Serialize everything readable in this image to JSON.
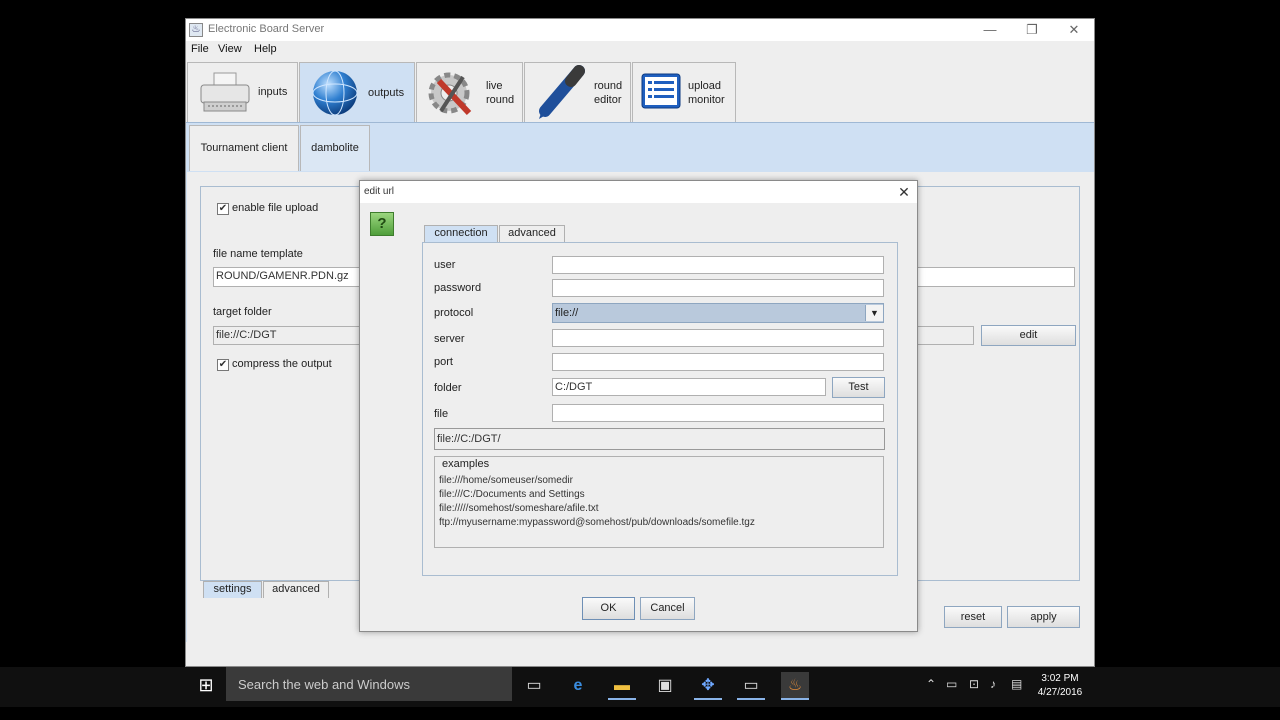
{
  "window": {
    "title": "Electronic Board Server",
    "controls": {
      "minimize": "—",
      "restore": "❐",
      "close": "✕"
    }
  },
  "menu": {
    "items": [
      "File",
      "View",
      "Help"
    ]
  },
  "toolbar_tabs": [
    {
      "label": "inputs",
      "icon": "printer-icon"
    },
    {
      "label": "outputs",
      "icon": "globe-icon"
    },
    {
      "label_line1": "live",
      "label_line2": "round",
      "icon": "tools-icon"
    },
    {
      "label_line1": "round",
      "label_line2": "editor",
      "icon": "marker-icon"
    },
    {
      "label_line1": "upload",
      "label_line2": "monitor",
      "icon": "list-monitor-icon"
    }
  ],
  "sub_tabs": [
    "Tournament client",
    "dambolite"
  ],
  "settings": {
    "enable_upload_label": "enable file upload",
    "enable_upload_checked": true,
    "file_name_template_label": "file name template",
    "file_name_template_value": "ROUND/GAMENR.PDN.gz",
    "target_folder_label": "target folder",
    "target_folder_value": "file://C:/DGT",
    "edit_button": "edit",
    "compress_label": "compress the output",
    "compress_checked": true,
    "bottom_tabs": [
      "settings",
      "advanced"
    ],
    "reset_button": "reset",
    "apply_button": "apply"
  },
  "dialog": {
    "title": "edit url",
    "close": "✕",
    "help": "?",
    "tabs": [
      "connection",
      "advanced"
    ],
    "user_label": "user",
    "user_value": "",
    "password_label": "password",
    "password_value": "",
    "protocol_label": "protocol",
    "protocol_value": "file://",
    "server_label": "server",
    "server_value": "",
    "port_label": "port",
    "port_value": "",
    "folder_label": "folder",
    "folder_value": "C:/DGT",
    "test_button": "Test",
    "file_label": "file",
    "file_value": "",
    "url_preview": "file://C:/DGT/",
    "examples_title": "examples",
    "examples": [
      "file:///home/someuser/somedir",
      "file:///C:/Documents and Settings",
      "file://///somehost/someshare/afile.txt",
      "ftp://myusername:mypassword@somehost/pub/downloads/somefile.tgz"
    ],
    "ok_button": "OK",
    "cancel_button": "Cancel"
  },
  "taskbar": {
    "search_placeholder": "Search the web and Windows",
    "time": "3:02 PM",
    "date": "4/27/2016"
  }
}
